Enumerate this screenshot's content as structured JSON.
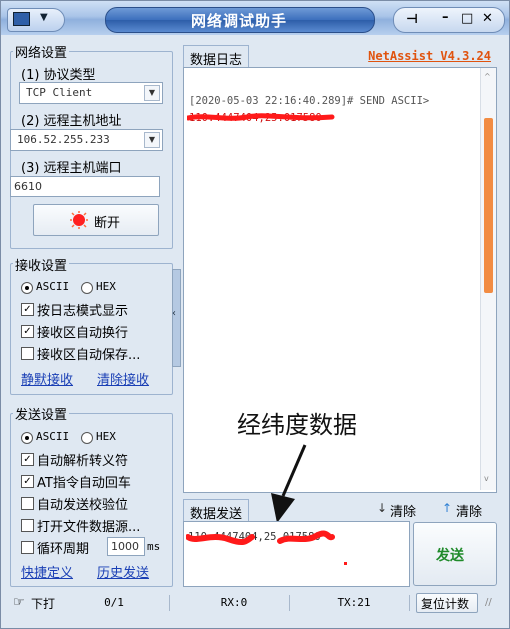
{
  "window": {
    "title": "网络调试助手"
  },
  "network": {
    "group_title": "网络设置",
    "protocol_label": "(1) 协议类型",
    "protocol_value": "TCP Client",
    "remote_ip_label": "(2) 远程主机地址",
    "remote_ip_value": "106.52.255.233",
    "remote_port_label": "(3) 远程主机端口",
    "remote_port_value": "6610",
    "disconnect_label": "断开"
  },
  "receive": {
    "group_title": "接收设置",
    "ascii_label": "ASCII",
    "hex_label": "HEX",
    "mode_selected": "ASCII",
    "options": [
      {
        "label": "按日志模式显示",
        "checked": true
      },
      {
        "label": "接收区自动换行",
        "checked": true
      },
      {
        "label": "接收区自动保存...",
        "checked": false
      }
    ],
    "save_link": "静默接收",
    "clear_link": "清除接收"
  },
  "send": {
    "group_title": "发送设置",
    "ascii_label": "ASCII",
    "hex_label": "HEX",
    "mode_selected": "ASCII",
    "options": [
      {
        "label": "自动解析转义符",
        "checked": true
      },
      {
        "label": "AT指令自动回车",
        "checked": true
      },
      {
        "label": "自动发送校验位",
        "checked": false
      },
      {
        "label": "打开文件数据源...",
        "checked": false
      }
    ],
    "loop_label": "循环周期",
    "loop_value": "1000",
    "loop_unit": "ms",
    "shortcut_link": "快捷定义",
    "history_link": "历史发送"
  },
  "log": {
    "tab_label": "数据日志",
    "version": "NetAssist V4.3.24",
    "entry_header": "[2020-05-03 22:16:40.289]# SEND ASCII>",
    "entry_body": "110.4447404,25.017580",
    "overlay_label": "经纬度数据"
  },
  "send_area": {
    "tab_label": "数据发送",
    "clear_log_label": "清除",
    "clear_send_label": "清除",
    "input_value": "110.4447404,25.017580",
    "send_button": "发送"
  },
  "status": {
    "download_label": "下打",
    "count": "0/1",
    "rx": "RX:0",
    "tx": "TX:21",
    "reset_label": "复位计数"
  },
  "colors": {
    "accent_orange": "#e0530f",
    "link_blue": "#1a3fb5",
    "red_scribble": "#ff1a1a"
  }
}
